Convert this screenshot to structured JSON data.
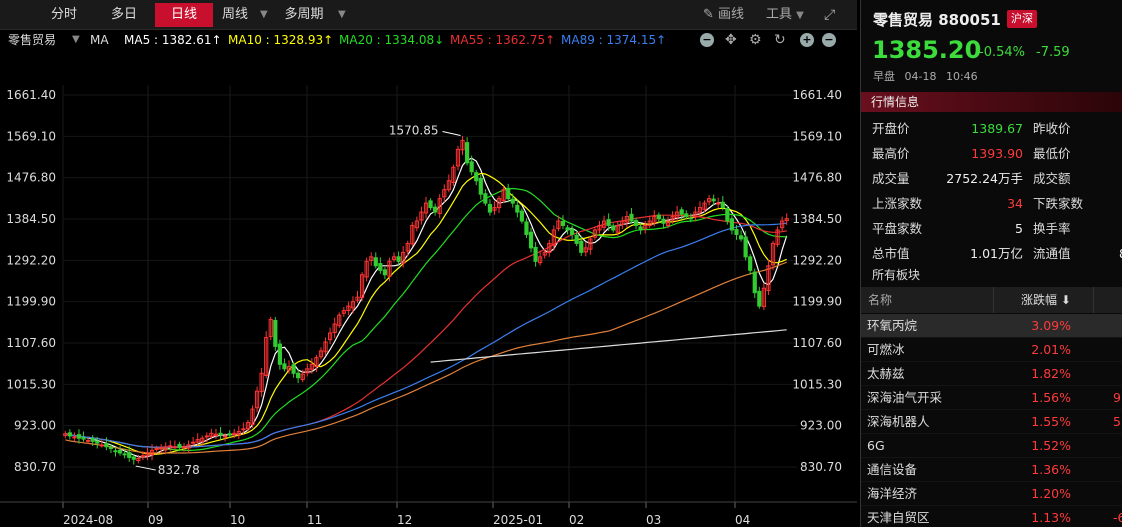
{
  "toolbar": {
    "tabs": [
      "分时",
      "多日",
      "日线",
      "周线",
      "多周期"
    ],
    "active_tab": "日线",
    "draw_label": "画线",
    "tools_label": "工具"
  },
  "ma_bar": {
    "name": "零售贸易",
    "type": "MA",
    "ma5": "MA5 : 1382.61↑",
    "ma10": "MA10 : 1328.93↑",
    "ma20": "MA20 : 1334.08↓",
    "ma55": "MA55 : 1362.75↑",
    "ma89": "MA89 : 1374.15↑",
    "colors": {
      "ma5": "#ffffff",
      "ma10": "#ffff00",
      "ma20": "#22dd22",
      "ma55": "#e83030",
      "ma89": "#3a7ff0"
    }
  },
  "chart_data": {
    "type": "candlestick",
    "y_ticks": [
      "1661.40",
      "1569.10",
      "1476.80",
      "1384.50",
      "1292.20",
      "1199.90",
      "1107.60",
      "1015.30",
      "923.00",
      "830.70"
    ],
    "ylim": [
      830.7,
      1661.4
    ],
    "x_ticks": [
      "2024-08",
      "09",
      "10",
      "11",
      "12",
      "2025-01",
      "02",
      "03",
      "04"
    ],
    "annotations": [
      {
        "label": "1570.85",
        "value": 1570.85,
        "kind": "high"
      },
      {
        "label": "832.78",
        "value": 832.78,
        "kind": "low"
      }
    ],
    "closes": [
      905,
      900,
      898,
      895,
      893,
      890,
      888,
      884,
      880,
      876,
      872,
      866,
      862,
      858,
      852,
      848,
      850,
      856,
      862,
      868,
      872,
      874,
      876,
      878,
      876,
      874,
      876,
      880,
      886,
      892,
      895,
      900,
      906,
      904,
      902,
      900,
      902,
      906,
      910,
      916,
      930,
      960,
      1000,
      1040,
      1120,
      1160,
      1100,
      1060,
      1050,
      1055,
      1040,
      1030,
      1038,
      1050,
      1060,
      1075,
      1090,
      1110,
      1130,
      1150,
      1170,
      1180,
      1190,
      1200,
      1210,
      1260,
      1290,
      1300,
      1280,
      1270,
      1260,
      1290,
      1300,
      1290,
      1310,
      1330,
      1370,
      1380,
      1400,
      1420,
      1410,
      1400,
      1430,
      1450,
      1470,
      1500,
      1540,
      1560,
      1510,
      1490,
      1470,
      1440,
      1420,
      1400,
      1410,
      1430,
      1450,
      1430,
      1420,
      1400,
      1380,
      1350,
      1320,
      1290,
      1300,
      1310,
      1330,
      1360,
      1380,
      1370,
      1360,
      1350,
      1330,
      1310,
      1320,
      1340,
      1360,
      1370,
      1380,
      1370,
      1360,
      1370,
      1380,
      1390,
      1380,
      1370,
      1360,
      1370,
      1380,
      1390,
      1385,
      1375,
      1380,
      1390,
      1400,
      1395,
      1390,
      1385,
      1400,
      1410,
      1420,
      1430,
      1425,
      1420,
      1410,
      1380,
      1360,
      1350,
      1340,
      1300,
      1270,
      1220,
      1190,
      1230,
      1280,
      1330,
      1360,
      1380,
      1385.2
    ]
  },
  "quote": {
    "title": "零售贸易 880051",
    "market": "沪深",
    "price": "1385.20",
    "pct": "-0.54%",
    "chg": "-7.59",
    "session": "早盘",
    "date": "04-18",
    "time": "10:46",
    "info_header": "行情信息",
    "rows": [
      {
        "k1": "开盘价",
        "v1": "1389.67",
        "c1": "green",
        "k2": "昨收价",
        "v2": ""
      },
      {
        "k1": "最高价",
        "v1": "1393.90",
        "c1": "red",
        "k2": "最低价",
        "v2": ""
      },
      {
        "k1": "成交量",
        "v1": "2752.24万手",
        "c1": "white",
        "k2": "成交额",
        "v2": ""
      },
      {
        "k1": "上涨家数",
        "v1": "34",
        "c1": "red",
        "k2": "下跌家数",
        "v2": ""
      },
      {
        "k1": "平盘家数",
        "v1": "5",
        "c1": "white",
        "k2": "换手率",
        "v2": ""
      },
      {
        "k1": "总市值",
        "v1": "1.01万亿",
        "c1": "white",
        "k2": "流通值",
        "v2": "8"
      }
    ],
    "sector_title": "所有板块",
    "sector_head": {
      "name": "名称",
      "pct": "涨跌幅 ⬇"
    },
    "sectors": [
      {
        "name": "环氧丙烷",
        "pct": "3.09%",
        "ext": ""
      },
      {
        "name": "可燃冰",
        "pct": "2.01%",
        "ext": ""
      },
      {
        "name": "太赫兹",
        "pct": "1.82%",
        "ext": ""
      },
      {
        "name": "深海油气开采",
        "pct": "1.56%",
        "ext": "9"
      },
      {
        "name": "深海机器人",
        "pct": "1.55%",
        "ext": "5"
      },
      {
        "name": "6G",
        "pct": "1.52%",
        "ext": ""
      },
      {
        "name": "通信设备",
        "pct": "1.36%",
        "ext": ""
      },
      {
        "name": "海洋经济",
        "pct": "1.20%",
        "ext": ""
      },
      {
        "name": "天津自贸区",
        "pct": "1.13%",
        "ext": "-6"
      }
    ]
  }
}
